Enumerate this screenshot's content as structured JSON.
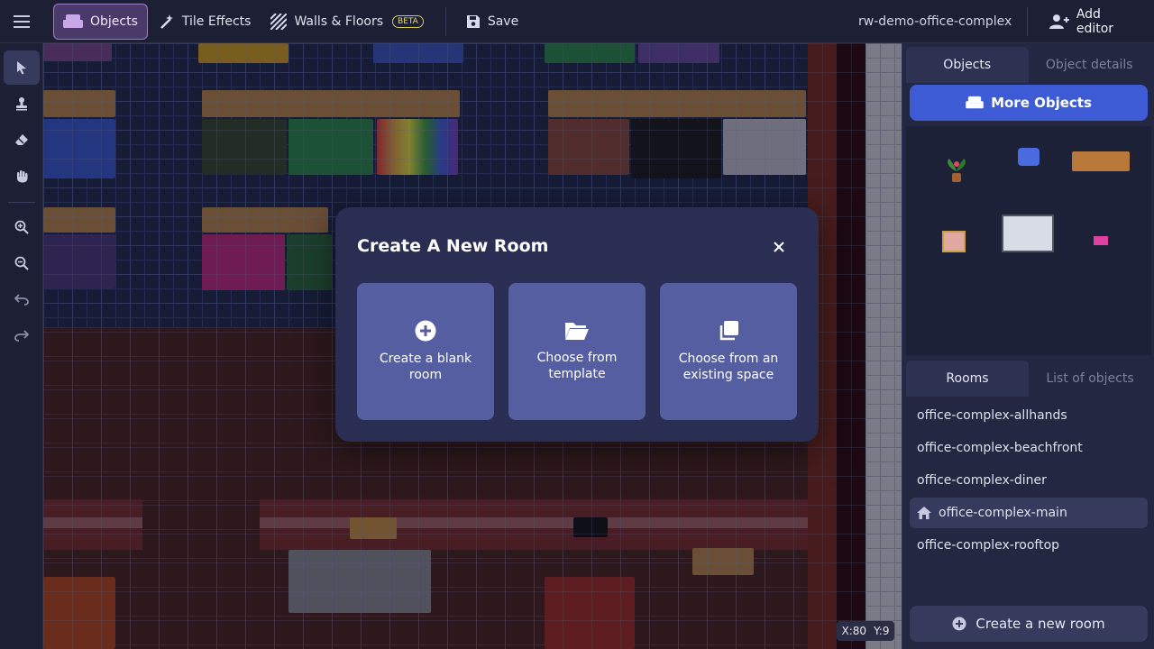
{
  "topbar": {
    "tabs": [
      {
        "label": "Objects",
        "icon": "couch-icon",
        "active": true
      },
      {
        "label": "Tile Effects",
        "icon": "magic-wand-icon",
        "active": false
      },
      {
        "label": "Walls & Floors",
        "icon": "hatch-icon",
        "active": false,
        "badge": "BETA"
      }
    ],
    "save_label": "Save",
    "space_name": "rw-demo-office-complex",
    "add_editor_label": "Add editor"
  },
  "left_tools": [
    "select-icon",
    "stamp-icon",
    "eraser-icon",
    "hand-icon",
    "zoom-in-icon",
    "zoom-out-icon",
    "undo-icon",
    "redo-icon"
  ],
  "coords": {
    "x": "X:80",
    "y": "Y:9"
  },
  "right_panel": {
    "tabs": [
      {
        "label": "Objects",
        "active": true
      },
      {
        "label": "Object details",
        "active": false
      }
    ],
    "more_objects_label": "More Objects",
    "rooms_tabs": [
      {
        "label": "Rooms",
        "active": true
      },
      {
        "label": "List of objects",
        "active": false
      }
    ],
    "rooms": [
      {
        "name": "office-complex-allhands",
        "active": false
      },
      {
        "name": "office-complex-beachfront",
        "active": false
      },
      {
        "name": "office-complex-diner",
        "active": false
      },
      {
        "name": "office-complex-main",
        "active": true,
        "home": true
      },
      {
        "name": "office-complex-rooftop",
        "active": false
      }
    ],
    "create_room_label": "Create a new room"
  },
  "modal": {
    "title": "Create A New Room",
    "options": [
      {
        "label": "Create a blank room",
        "icon": "plus-circle-icon"
      },
      {
        "label": "Choose from template",
        "icon": "folder-open-icon"
      },
      {
        "label": "Choose from an existing space",
        "icon": "copy-icon"
      }
    ]
  },
  "colors": {
    "accent_blue": "#3d5bd4",
    "modal_bg": "#2a2e52",
    "option_bg": "#545ea0",
    "active_tab": "#4a3a6a",
    "beta": "#e8da6a"
  }
}
